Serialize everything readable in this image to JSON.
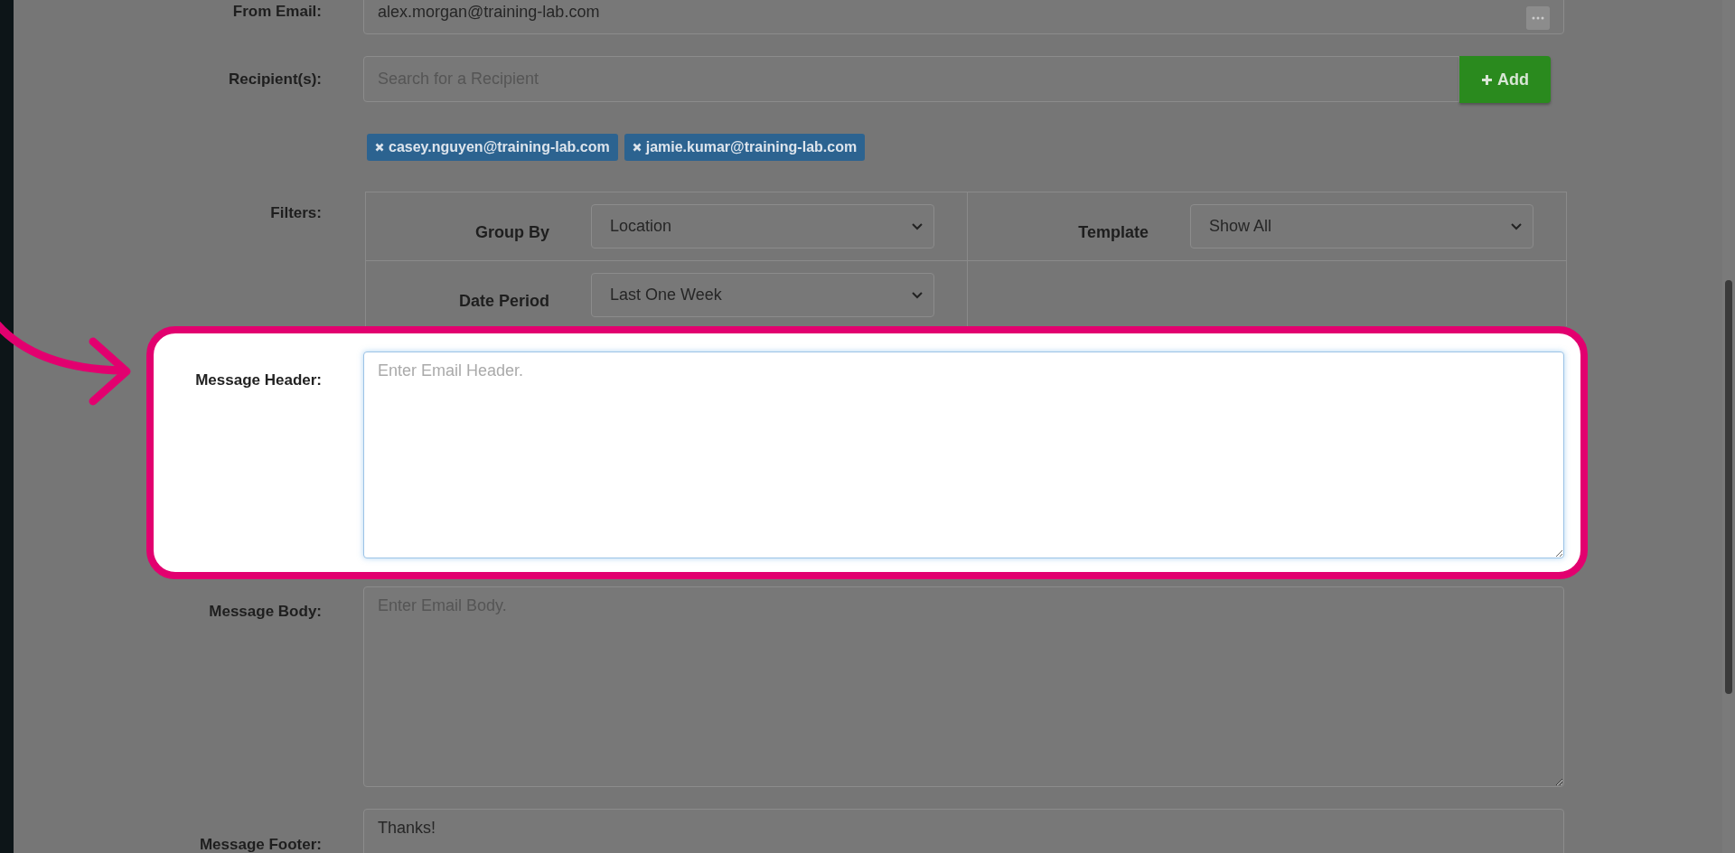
{
  "form": {
    "from_email": {
      "label": "From Email:",
      "value": "alex.morgan@training-lab.com"
    },
    "recipients": {
      "label": "Recipient(s):",
      "placeholder": "Search for a Recipient",
      "add_button": "Add",
      "tags": [
        {
          "label": "casey.nguyen@training-lab.com"
        },
        {
          "label": "jamie.kumar@training-lab.com"
        }
      ]
    },
    "filters": {
      "label": "Filters:",
      "fields": [
        {
          "label": "Group By",
          "value": "Location"
        },
        {
          "label": "Template",
          "value": "Show All"
        },
        {
          "label": "Date Period",
          "value": "Last One Week"
        }
      ]
    },
    "messages": [
      {
        "label": "Message Header:",
        "placeholder": "Enter Email Header.",
        "highlighted": true
      },
      {
        "label": "Message Body:",
        "placeholder": "Enter Email Body.",
        "highlighted": false
      },
      {
        "label": "Message Footer:",
        "value": "Thanks!",
        "highlighted": false
      }
    ]
  }
}
